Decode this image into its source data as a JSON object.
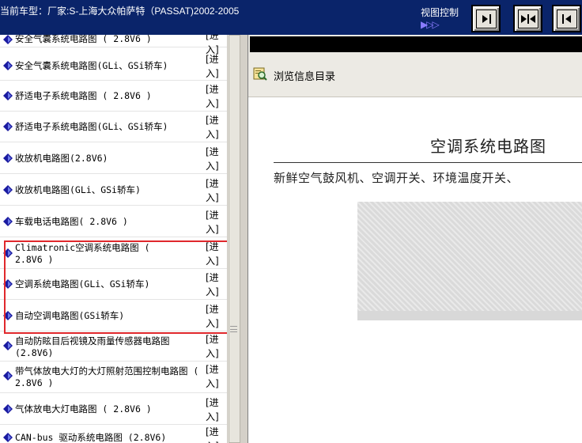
{
  "header": {
    "title": "当前车型：厂家:S-上海大众帕萨特（PASSAT)2002-2005",
    "view_control_label": "视图控制",
    "view_control_arrow": "▶▷▷"
  },
  "view_buttons": [
    {
      "name": "expand-right",
      "glyph": "→▮"
    },
    {
      "name": "split-center",
      "glyph": "▶◀"
    },
    {
      "name": "expand-left",
      "glyph": "◀▮"
    }
  ],
  "list": {
    "enter_label": "[进入]",
    "items": [
      {
        "label": "安全气囊系统电路图 ( 2.8V6 )"
      },
      {
        "label": "安全气囊系统电路图(GLi、GSi轿车)"
      },
      {
        "label": "舒适电子系统电路图 ( 2.8V6 )"
      },
      {
        "label": "舒适电子系统电路图(GLi、GSi轿车)"
      },
      {
        "label": "收放机电路图(2.8V6)"
      },
      {
        "label": "收放机电路图(GLi、GSi轿车)"
      },
      {
        "label": "车载电话电路图( 2.8V6 )"
      },
      {
        "label": "Climatronic空调系统电路图 ( 2.8V6 )"
      },
      {
        "label": "空调系统电路图(GLi、GSi轿车)"
      },
      {
        "label": "自动空调电路图(GSi轿车)"
      },
      {
        "label": "自动防眩目后视镜及雨量传感器电路图(2.8V6)"
      },
      {
        "label": "带气体放电大灯的大灯照射范围控制电路图 ( 2.8V6 )"
      },
      {
        "label": "气体放电大灯电路图 ( 2.8V6 )"
      },
      {
        "label": "CAN-bus 驱动系统电路图 (2.8V6)"
      }
    ]
  },
  "content": {
    "browse_label": "浏览信息目录",
    "doc_title": "空调系统电路图",
    "doc_subtitle": "新鲜空气鼓风机、空调开关、环境温度开关、"
  },
  "colors": {
    "title_bar": "#0a246a",
    "highlight_border": "#e0282c",
    "item_icon": "#1a1aa0"
  }
}
